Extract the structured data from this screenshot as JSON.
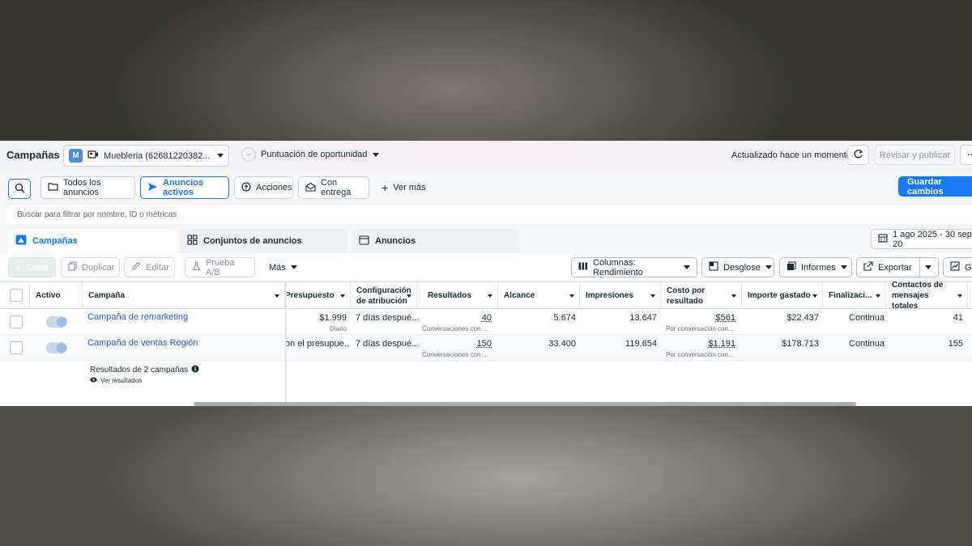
{
  "header": {
    "title": "Campañas",
    "account_badge": "M",
    "account_name": "Muebleria (62681220382...",
    "opportunity_label": "Puntuación de oportunidad",
    "opportunity_value": "--",
    "updated_text": "Actualizado hace un momento",
    "review_button": "Revisar y publicar",
    "more_button": "···"
  },
  "filters": {
    "chips": [
      "Todos los anuncios",
      "Anuncios activos",
      "Acciones",
      "Con entrega"
    ],
    "active_chip": "Anuncios activos",
    "see_more": "Ver más",
    "save_button": "Guardar cambios",
    "search_placeholder": "Buscar para filtrar por nombre, ID o métricas"
  },
  "tabs": {
    "items": [
      "Campañas",
      "Conjuntos de anuncios",
      "Anuncios"
    ],
    "selected": "Campañas",
    "date_range": "1 ago 2025 - 30 sep 20"
  },
  "toolbar": {
    "create": "Crear",
    "duplicate": "Duplicar",
    "edit": "Editar",
    "ab_test": "Prueba A/B",
    "more": "Más",
    "columns": "Columnas: Rendimiento",
    "breakdown": "Desglose",
    "reports": "Informes",
    "export": "Exportar",
    "charts_partial": "Gr"
  },
  "table": {
    "headers": {
      "active": "Activo",
      "campaign": "Campaña",
      "budget": "Presupuesto",
      "attribution": "Configuración de atribución",
      "results": "Resultados",
      "reach": "Alcance",
      "impressions": "Impresiones",
      "cost_per_result": "Costo por resultado",
      "amount_spent": "Importe gastado",
      "ends": "Finalizaci...",
      "contacts": "Contactos de mensajes totales"
    },
    "rows": [
      {
        "campaign": "Campaña de remarketing",
        "budget": "$1.999",
        "budget_sub": "Diario",
        "attribution": "7 días despué...",
        "results": "40",
        "results_sub": "Conversaciones con ...",
        "reach": "5.674",
        "impressions": "13.647",
        "cost_per_result": "$561",
        "cost_sub": "Por conversación con...",
        "amount_spent": "$22.437",
        "ends": "Continua",
        "contacts": "41"
      },
      {
        "campaign": "Campaña de ventas Región",
        "budget": "on el presupue...",
        "budget_sub": "",
        "attribution": "7 días despué...",
        "results": "150",
        "results_sub": "Conversaciones con ...",
        "reach": "33.400",
        "impressions": "119.654",
        "cost_per_result": "$1.191",
        "cost_sub": "Por conversación con...",
        "amount_spent": "$178.713",
        "ends": "Continua",
        "contacts": "155"
      }
    ],
    "summary": "Resultados de 2 campañas",
    "summary_sub": "Ver resultados"
  },
  "colors": {
    "accent": "#1877f2",
    "link": "#1a5fd0",
    "text": "#1c2b33"
  }
}
